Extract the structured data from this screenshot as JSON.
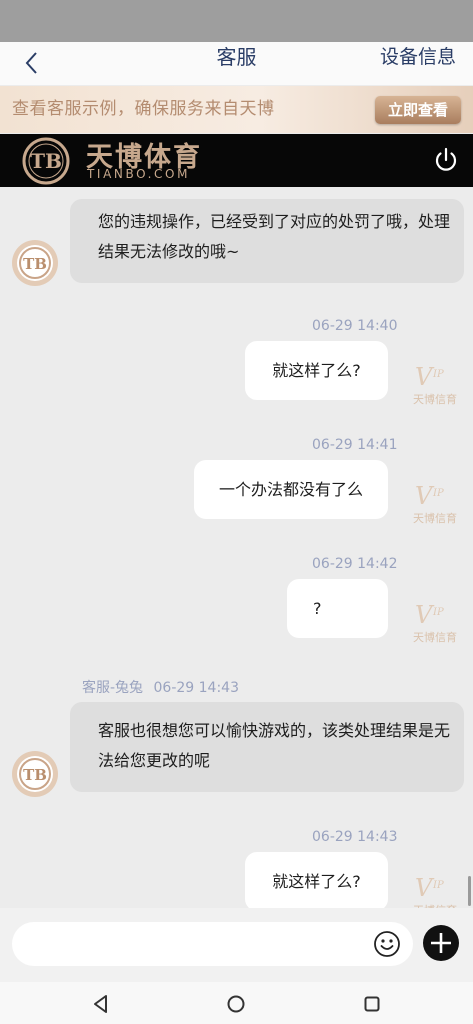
{
  "nav": {
    "title": "客服",
    "right_label": "设备信息",
    "back_icon": "chevron-left-icon"
  },
  "promo": {
    "text": "查看客服示例，确保服务来自天博",
    "button_label": "立即查看"
  },
  "brand": {
    "name": "天博体育",
    "url": "TIANBO.COM",
    "logo_letters": "TB",
    "power_icon": "power-icon"
  },
  "messages": [
    {
      "side": "in",
      "text": "您的违规操作，已经受到了对应的处罚了哦，处理结果无法修改的哦~"
    },
    {
      "side": "out",
      "time": "06-29 14:40",
      "text": "就这样了么?"
    },
    {
      "side": "out",
      "time": "06-29 14:41",
      "text": "一个办法都没有了么"
    },
    {
      "side": "out",
      "time": "06-29 14:42",
      "text": "?"
    },
    {
      "side": "in",
      "sender": "客服-兔兔",
      "time": "06-29 14:43",
      "text": "客服也很想您可以愉快游戏的，该类处理结果是无法给您更改的呢"
    },
    {
      "side": "out",
      "time": "06-29 14:43",
      "text": "就这样了么?"
    }
  ],
  "vip_badge": {
    "mark": "VIP",
    "caption": "天博信育"
  },
  "input": {
    "placeholder": "",
    "emoji_icon": "smiley-icon",
    "plus_icon": "plus-icon"
  },
  "system_nav": [
    "back-triangle-icon",
    "home-circle-icon",
    "recents-square-icon"
  ],
  "colors": {
    "accent_gold": "#c7a88d",
    "nav_text": "#2a3d66",
    "timestamp": "#9aa3bf"
  }
}
